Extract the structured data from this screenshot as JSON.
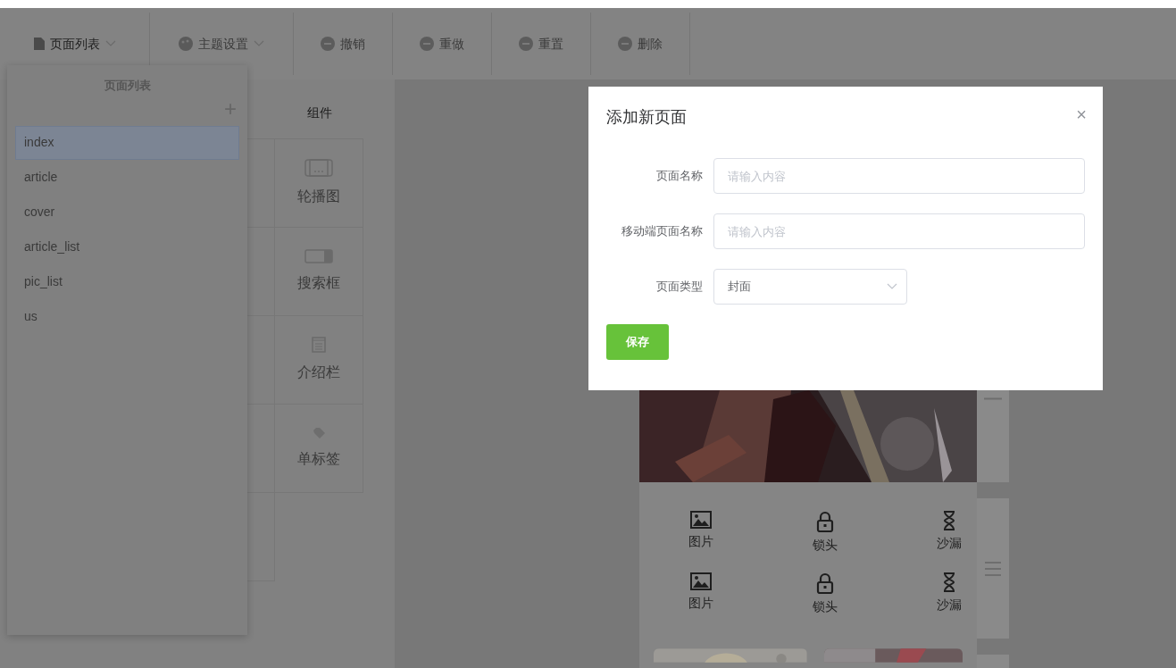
{
  "toolbar": {
    "items": [
      {
        "label": "页面列表",
        "dropdown": true,
        "active": true
      },
      {
        "label": "主题设置",
        "dropdown": true,
        "active": false
      },
      {
        "label": "撤销",
        "dropdown": false,
        "active": false
      },
      {
        "label": "重做",
        "dropdown": false,
        "active": false
      },
      {
        "label": "重置",
        "dropdown": false,
        "active": false
      },
      {
        "label": "删除",
        "dropdown": false,
        "active": false
      }
    ]
  },
  "page_list": {
    "title": "页面列表",
    "add_button": "+",
    "items": [
      {
        "label": "index",
        "selected": true
      },
      {
        "label": "article",
        "selected": false
      },
      {
        "label": "cover",
        "selected": false
      },
      {
        "label": "article_list",
        "selected": false
      },
      {
        "label": "pic_list",
        "selected": false
      },
      {
        "label": "us",
        "selected": false
      }
    ]
  },
  "components": {
    "tab": "组件",
    "items": [
      {
        "label": "轮播图"
      },
      {
        "label": "搜索框"
      },
      {
        "label": "介绍栏"
      },
      {
        "label": "单标签"
      }
    ]
  },
  "preview": {
    "nav_items": [
      {
        "label": "图片"
      },
      {
        "label": "锁头"
      },
      {
        "label": "沙漏"
      },
      {
        "label": "图片"
      },
      {
        "label": "锁头"
      },
      {
        "label": "沙漏"
      }
    ]
  },
  "dialog": {
    "title": "添加新页面",
    "close": "×",
    "fields": [
      {
        "kind": "input",
        "label": "页面名称",
        "placeholder": "请输入内容"
      },
      {
        "kind": "input",
        "label": "移动端页面名称",
        "placeholder": "请输入内容"
      },
      {
        "kind": "select",
        "label": "页面类型",
        "value": "封面"
      }
    ],
    "save_button": "保存"
  }
}
